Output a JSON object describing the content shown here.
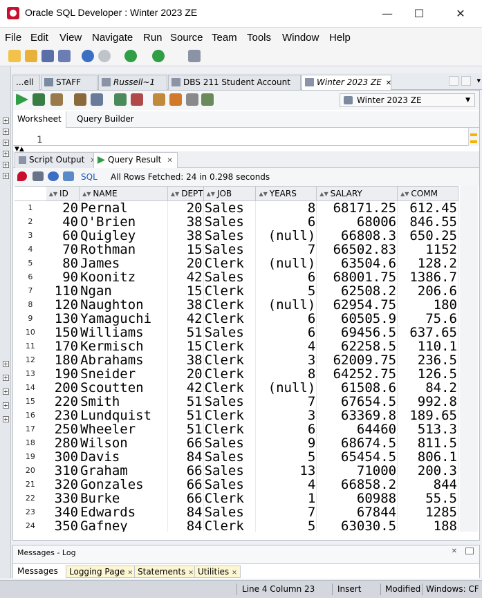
{
  "window": {
    "title": "Oracle SQL Developer : Winter 2023 ZE"
  },
  "menu": [
    "File",
    "Edit",
    "View",
    "Navigate",
    "Run",
    "Source",
    "Team",
    "Tools",
    "Window",
    "Help"
  ],
  "doc_tabs": [
    {
      "label": "...ell"
    },
    {
      "label": "STAFF"
    },
    {
      "label": "Russell~1"
    },
    {
      "label": "DBS 211 Student Account"
    },
    {
      "label": "Winter 2023 ZE"
    }
  ],
  "connection": {
    "selected": "Winter 2023 ZE"
  },
  "editor_tabs": {
    "worksheet": "Worksheet",
    "query_builder": "Query Builder"
  },
  "sql_editor": {
    "line_number": "1"
  },
  "result_tabs": {
    "script_output": "Script Output",
    "query_result": "Query Result"
  },
  "result_toolbar": {
    "sql_label": "SQL",
    "fetched": "All Rows Fetched: 24 in 0.298 seconds"
  },
  "columns": [
    "ID",
    "NAME",
    "DEPT",
    "JOB",
    "YEARS",
    "SALARY",
    "COMM"
  ],
  "rows": [
    [
      "1",
      "20",
      "Pernal",
      "20",
      "Sales",
      "8",
      "68171.25",
      "612.45"
    ],
    [
      "2",
      "40",
      "O'Brien",
      "38",
      "Sales",
      "6",
      "68006",
      "846.55"
    ],
    [
      "3",
      "60",
      "Quigley",
      "38",
      "Sales",
      "(null)",
      "66808.3",
      "650.25"
    ],
    [
      "4",
      "70",
      "Rothman",
      "15",
      "Sales",
      "7",
      "66502.83",
      "1152"
    ],
    [
      "5",
      "80",
      "James",
      "20",
      "Clerk",
      "(null)",
      "63504.6",
      "128.2"
    ],
    [
      "6",
      "90",
      "Koonitz",
      "42",
      "Sales",
      "6",
      "68001.75",
      "1386.7"
    ],
    [
      "7",
      "110",
      "Ngan",
      "15",
      "Clerk",
      "5",
      "62508.2",
      "206.6"
    ],
    [
      "8",
      "120",
      "Naughton",
      "38",
      "Clerk",
      "(null)",
      "62954.75",
      "180"
    ],
    [
      "9",
      "130",
      "Yamaguchi",
      "42",
      "Clerk",
      "6",
      "60505.9",
      "75.6"
    ],
    [
      "10",
      "150",
      "Williams",
      "51",
      "Sales",
      "6",
      "69456.5",
      "637.65"
    ],
    [
      "11",
      "170",
      "Kermisch",
      "15",
      "Clerk",
      "4",
      "62258.5",
      "110.1"
    ],
    [
      "12",
      "180",
      "Abrahams",
      "38",
      "Clerk",
      "3",
      "62009.75",
      "236.5"
    ],
    [
      "13",
      "190",
      "Sneider",
      "20",
      "Clerk",
      "8",
      "64252.75",
      "126.5"
    ],
    [
      "14",
      "200",
      "Scoutten",
      "42",
      "Clerk",
      "(null)",
      "61508.6",
      "84.2"
    ],
    [
      "15",
      "220",
      "Smith",
      "51",
      "Sales",
      "7",
      "67654.5",
      "992.8"
    ],
    [
      "16",
      "230",
      "Lundquist",
      "51",
      "Clerk",
      "3",
      "63369.8",
      "189.65"
    ],
    [
      "17",
      "250",
      "Wheeler",
      "51",
      "Clerk",
      "6",
      "64460",
      "513.3"
    ],
    [
      "18",
      "280",
      "Wilson",
      "66",
      "Sales",
      "9",
      "68674.5",
      "811.5"
    ],
    [
      "19",
      "300",
      "Davis",
      "84",
      "Sales",
      "5",
      "65454.5",
      "806.1"
    ],
    [
      "20",
      "310",
      "Graham",
      "66",
      "Sales",
      "13",
      "71000",
      "200.3"
    ],
    [
      "21",
      "320",
      "Gonzales",
      "66",
      "Sales",
      "4",
      "66858.2",
      "844"
    ],
    [
      "22",
      "330",
      "Burke",
      "66",
      "Clerk",
      "1",
      "60988",
      "55.5"
    ],
    [
      "23",
      "340",
      "Edwards",
      "84",
      "Sales",
      "7",
      "67844",
      "1285"
    ],
    [
      "24",
      "350",
      "Gafney",
      "84",
      "Clerk",
      "5",
      "63030.5",
      "188"
    ]
  ],
  "log": {
    "title": "Messages - Log",
    "tabs": [
      "Messages",
      "Logging Page",
      "Statements",
      "Utilities"
    ]
  },
  "status": {
    "position": "Line 4 Column 23",
    "mode": "Insert",
    "modified": "Modified",
    "encoding": "Windows: CF"
  },
  "colors": {
    "tab_highlight": "#fdf6d2",
    "sql_link": "#1a55b4",
    "app_icon": "#c8102e"
  }
}
